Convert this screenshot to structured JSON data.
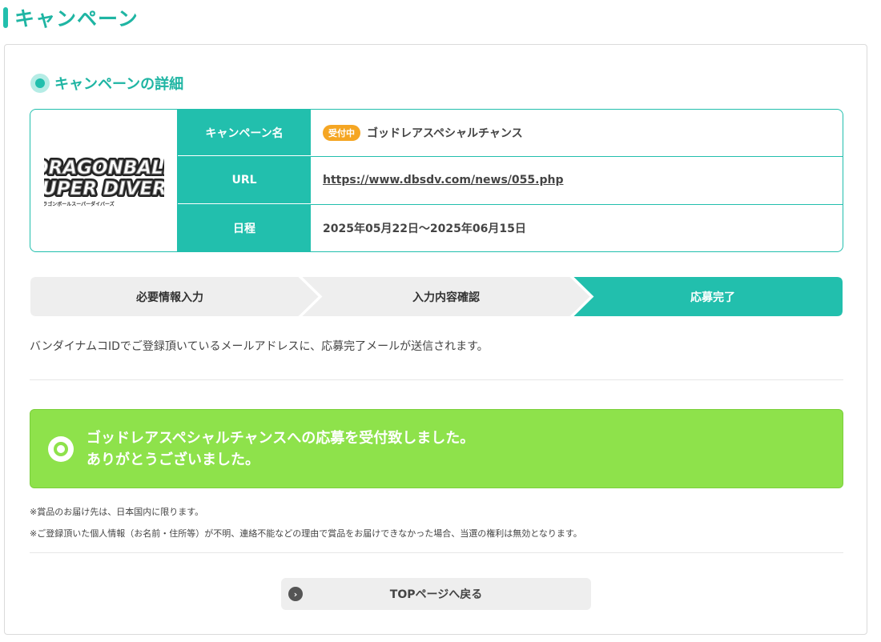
{
  "page": {
    "title": "キャンペーン"
  },
  "section": {
    "heading": "キャンペーンの詳細"
  },
  "logo": {
    "alt": "DRAGONBALL SUPER DIVERS",
    "line1": "DRAGONBALL",
    "line2": "SUPER DIVERS",
    "sub": "ドラゴンボールスーパーダイバーズ"
  },
  "info": {
    "name_label": "キャンペーン名",
    "status_badge": "受付中",
    "name_value": "ゴッドレアスペシャルチャンス",
    "url_label": "URL",
    "url_value": "https://www.dbsdv.com/news/055.php",
    "schedule_label": "日程",
    "schedule_value": "2025年05月22日〜2025年06月15日"
  },
  "steps": [
    {
      "label": "必要情報入力",
      "active": false
    },
    {
      "label": "入力内容確認",
      "active": false
    },
    {
      "label": "応募完了",
      "active": true
    }
  ],
  "notice": "バンダイナムコIDでご登録頂いているメールアドレスに、応募完了メールが送信されます。",
  "success": {
    "line1": "ゴッドレアスペシャルチャンスへの応募を受付致しました。",
    "line2": "ありがとうございました。"
  },
  "notes": [
    "※賞品のお届け先は、日本国内に限ります。",
    "※ご登録頂いた個人情報（お名前・住所等）が不明、連絡不能などの理由で賞品をお届けできなかった場合、当選の権利は無効となります。"
  ],
  "top_button": {
    "label": "TOPページへ戻る",
    "icon": "chevron-right-icon"
  },
  "colors": {
    "teal": "#22bfad",
    "green": "#8ee24b",
    "badge": "#f5a623",
    "step_inactive": "#eeeeee"
  }
}
